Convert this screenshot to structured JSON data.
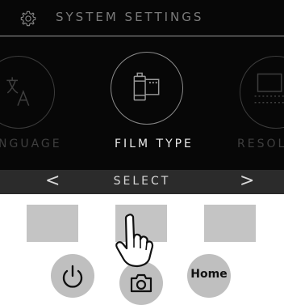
{
  "header": {
    "title": "SYSTEM SETTINGS",
    "icon": "gear-icon"
  },
  "carousel": {
    "items": [
      {
        "label": "NGUAGE",
        "icon": "language-icon",
        "state": "inactive"
      },
      {
        "label": "FILM TYPE",
        "icon": "film-roll-icon",
        "state": "active"
      },
      {
        "label": "RESOLU",
        "icon": "resolution-icon",
        "state": "inactive"
      }
    ]
  },
  "bottom_bar": {
    "prev": "<",
    "action": "SELECT",
    "next": ">"
  },
  "hardware": {
    "keys": [
      "left-key",
      "center-key",
      "right-key"
    ],
    "buttons": [
      {
        "icon": "power-icon"
      },
      {
        "icon": "camera-icon"
      },
      {
        "label": "Home"
      }
    ]
  },
  "colors": {
    "screen_bg": "#070707",
    "bar_bg": "#2b2b2b",
    "key_gray": "#c4c4c4"
  }
}
